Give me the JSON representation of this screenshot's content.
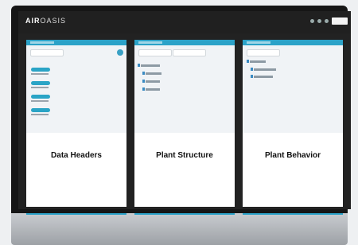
{
  "app": {
    "logo_main": "AIR",
    "logo_light": "OASIS"
  },
  "panels": [
    {
      "title": "Data Headers"
    },
    {
      "title": "Plant Structure"
    },
    {
      "title": "Plant Behavior"
    }
  ],
  "colors": {
    "accent": "#2ba2c8",
    "screen_bg": "#222222",
    "panel_bg": "#ffffff"
  },
  "icons": {
    "add": "plus-circle-icon",
    "tree_node": "tree-node-icon",
    "status_dot": "status-dot-icon"
  }
}
